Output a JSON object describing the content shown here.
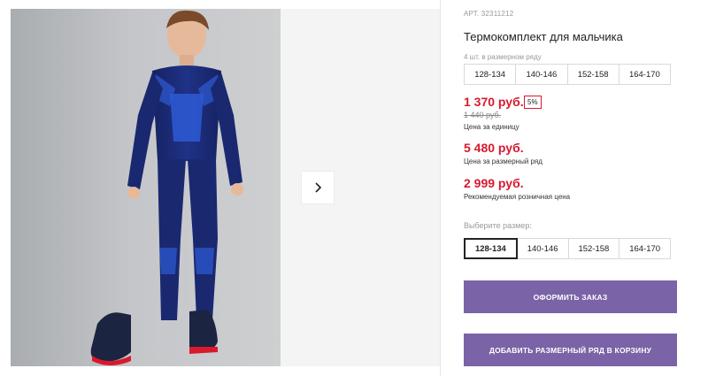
{
  "product": {
    "article": "АРТ. 32311212",
    "title": "Термокомплект для мальчика",
    "pack_note": "4 шт. в размерном ряду",
    "pack_sizes": [
      "128-134",
      "140-146",
      "152-158",
      "164-170"
    ],
    "price": "1 370 руб.",
    "discount": "5%",
    "old_price": "1 440 руб.",
    "unit_label": "Цена за единицу",
    "row_price": "5 480 руб.",
    "row_label": "Цена за размерный ряд",
    "rrp_price": "2 999 руб.",
    "rrp_label": "Рекомендуемая розничная цена",
    "choose_label": "Выберите размер:",
    "sizes": [
      "128-134",
      "140-146",
      "152-158",
      "164-170"
    ],
    "selected_size": "128-134",
    "order_button": "ОФОРМИТЬ ЗАКАЗ",
    "basket_button": "ДОБАВИТЬ РАЗМЕРНЫЙ РЯД В КОРЗИНУ"
  },
  "gallery": {
    "next_icon": "chevron-right-icon"
  },
  "colors": {
    "price_red": "#d8192e",
    "button_purple": "#7a63a6",
    "suit_navy": "#1b2a6b",
    "suit_blue": "#2e5bd6"
  }
}
